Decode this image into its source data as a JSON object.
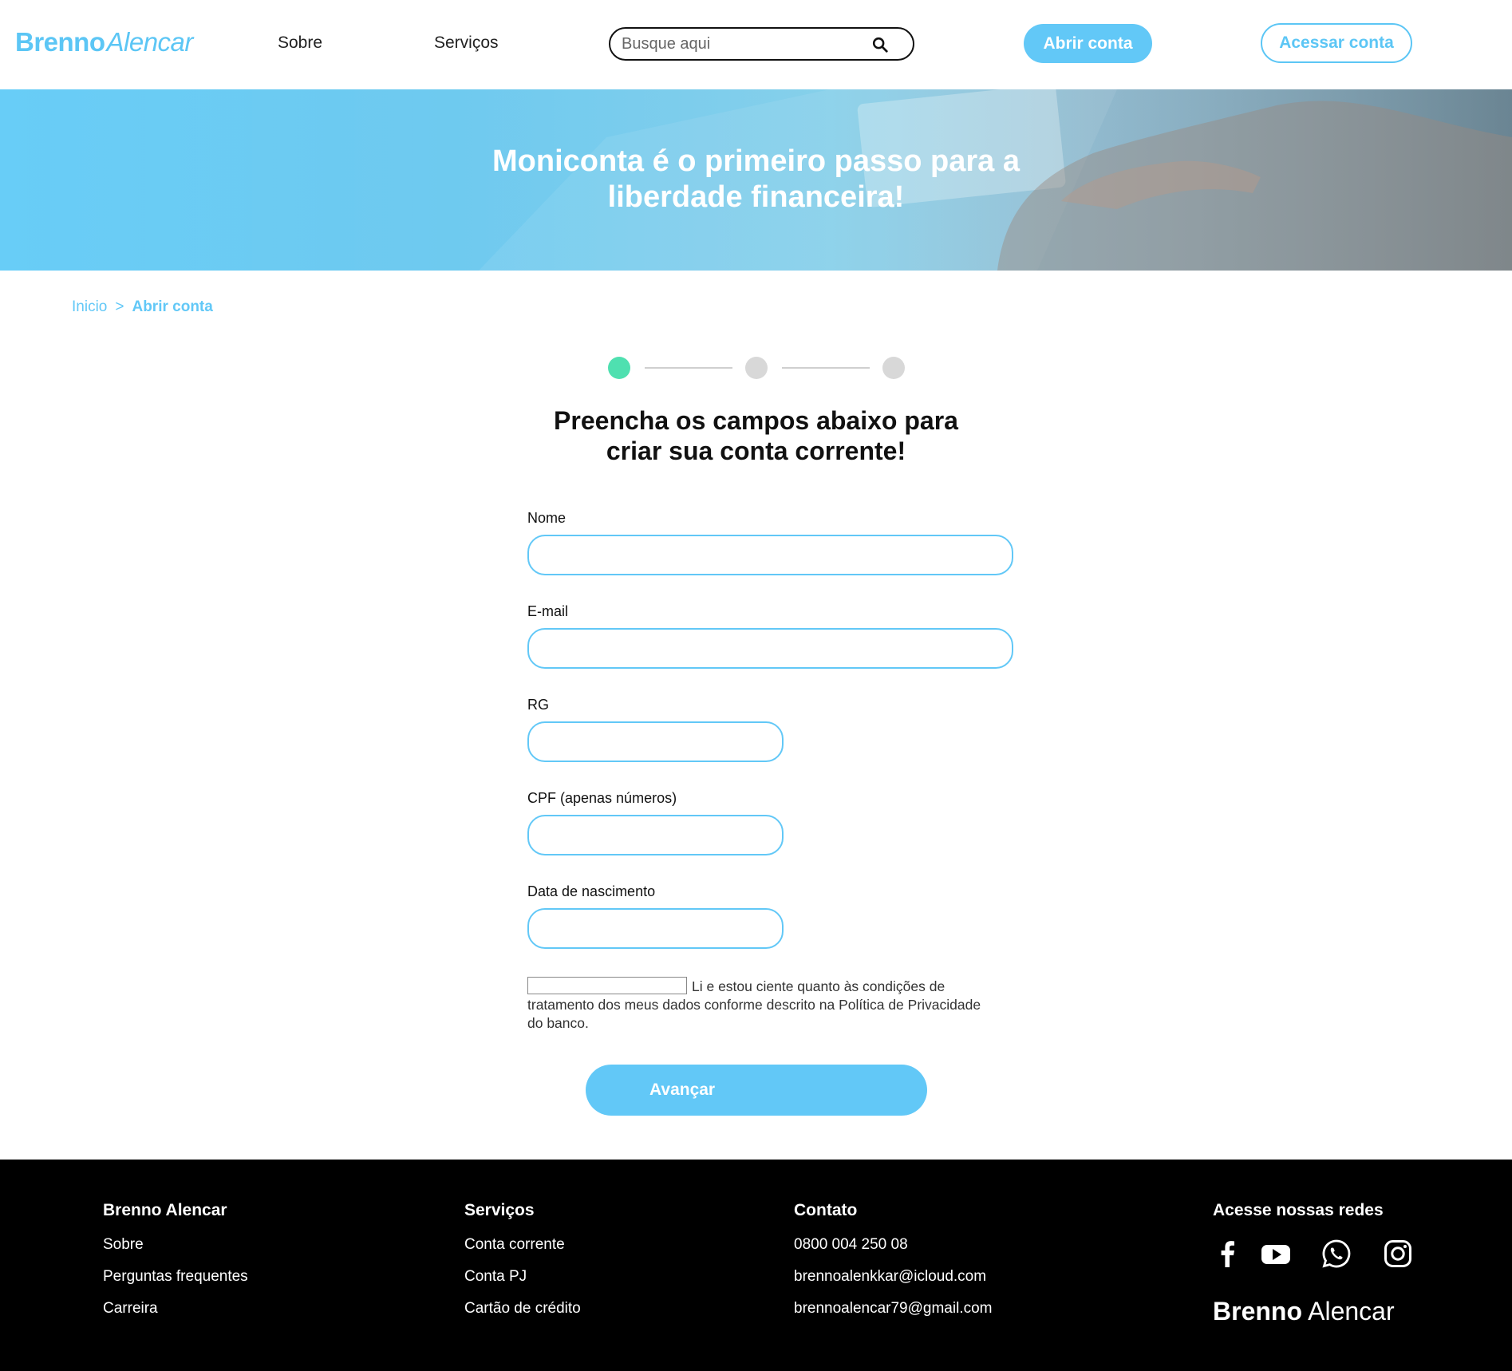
{
  "brand": {
    "first": "Brenno",
    "second": "Alencar"
  },
  "nav": {
    "about": "Sobre",
    "services": "Serviços"
  },
  "search": {
    "placeholder": "Busque aqui"
  },
  "header_buttons": {
    "open_account": "Abrir conta",
    "access_account": "Acessar conta"
  },
  "hero": {
    "line1": "Moniconta é o primeiro passo para a",
    "line2": "liberdade financeira!"
  },
  "breadcrumb": {
    "home": "Inicio",
    "separator": ">",
    "current": "Abrir conta"
  },
  "stepper": {
    "current_step": 1,
    "total_steps": 3
  },
  "form": {
    "title_line1": "Preencha os campos abaixo para",
    "title_line2": "criar sua conta corrente!",
    "name_label": "Nome",
    "email_label": "E-mail",
    "rg_label": "RG",
    "cpf_label": "CPF (apenas números)",
    "birth_label": "Data de nascimento",
    "consent_text": "Li e estou ciente quanto às condições de tratamento dos meus dados conforme descrito na Política de Privacidade do banco.",
    "submit_label": "Avançar"
  },
  "footer": {
    "col1": {
      "title": "Brenno Alencar",
      "items": [
        "Sobre",
        "Perguntas frequentes",
        "Carreira"
      ]
    },
    "col2": {
      "title": "Serviços",
      "items": [
        "Conta corrente",
        "Conta PJ",
        "Cartão de crédito"
      ]
    },
    "col3": {
      "title": "Contato",
      "items": [
        "0800 004 250 08",
        "brennoalenkkar@icloud.com",
        "brennoalencar79@gmail.com"
      ]
    },
    "col4": {
      "title": "Acesse nossas redes"
    },
    "social_icons": [
      "facebook-icon",
      "youtube-icon",
      "whatsapp-icon",
      "instagram-icon"
    ],
    "logo": {
      "first": "Brenno",
      "second": "Alencar"
    }
  },
  "colors": {
    "accent": "#62c8f7",
    "step_active": "#4fe0b0",
    "step_inactive": "#d8d8d8",
    "footer_bg": "#000000"
  }
}
